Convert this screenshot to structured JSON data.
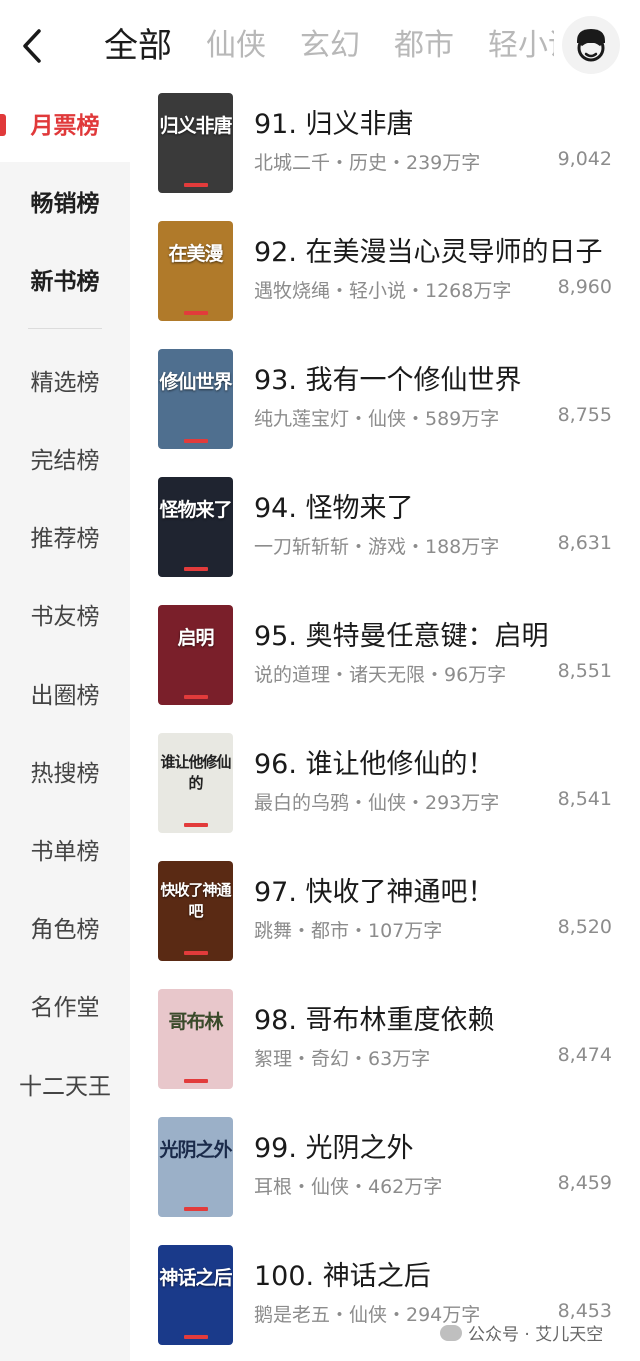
{
  "header": {
    "tabs": [
      "全部",
      "仙侠",
      "玄幻",
      "都市",
      "轻小说"
    ],
    "active_tab": 0
  },
  "sidebar": {
    "items": [
      "月票榜",
      "畅销榜",
      "新书榜",
      "精选榜",
      "完结榜",
      "推荐榜",
      "书友榜",
      "出圈榜",
      "热搜榜",
      "书单榜",
      "角色榜",
      "名作堂",
      "十二天王"
    ],
    "active_index": 0
  },
  "books": [
    {
      "title": "91. 归义非唐",
      "meta": "北城二千・历史・239万字",
      "votes": "9,042",
      "cover_text": "归义非唐",
      "cover_color": "#3a3a3a"
    },
    {
      "title": "92. 在美漫当心灵导师的日子",
      "meta": "遇牧烧绳・轻小说・1268万字",
      "votes": "8,960",
      "cover_text": "在美漫",
      "cover_color": "#b07a2a"
    },
    {
      "title": "93. 我有一个修仙世界",
      "meta": "纯九莲宝灯・仙侠・589万字",
      "votes": "8,755",
      "cover_text": "修仙世界",
      "cover_color": "#4f6f8f"
    },
    {
      "title": "94. 怪物来了",
      "meta": "一刀斩斩斩・游戏・188万字",
      "votes": "8,631",
      "cover_text": "怪物来了",
      "cover_color": "#1f2430"
    },
    {
      "title": "95. 奥特曼任意键：启明",
      "meta": "说的道理・诸天无限・96万字",
      "votes": "8,551",
      "cover_text": "启明",
      "cover_color": "#7a1f2a"
    },
    {
      "title": "96. 谁让他修仙的！",
      "meta": "最白的乌鸦・仙侠・293万字",
      "votes": "8,541",
      "cover_text": "谁让他修仙的",
      "cover_color": "#e8e8e2"
    },
    {
      "title": "97. 快收了神通吧！",
      "meta": "跳舞・都市・107万字",
      "votes": "8,520",
      "cover_text": "快收了神通吧",
      "cover_color": "#5a2a14"
    },
    {
      "title": "98. 哥布林重度依赖",
      "meta": "絮理・奇幻・63万字",
      "votes": "8,474",
      "cover_text": "哥布林",
      "cover_color": "#e8c7cb"
    },
    {
      "title": "99. 光阴之外",
      "meta": "耳根・仙侠・462万字",
      "votes": "8,459",
      "cover_text": "光阴之外",
      "cover_color": "#9bb0c8"
    },
    {
      "title": "100. 神话之后",
      "meta": "鹅是老五・仙侠・294万字",
      "votes": "8,453",
      "cover_text": "神话之后",
      "cover_color": "#1a3a8a"
    }
  ],
  "watermark": {
    "text": "公众号 · 艾儿天空"
  },
  "colors": {
    "accent": "#e0393a",
    "sidebar_bg": "#f5f5f5",
    "meta_text": "#8c8c8c"
  }
}
